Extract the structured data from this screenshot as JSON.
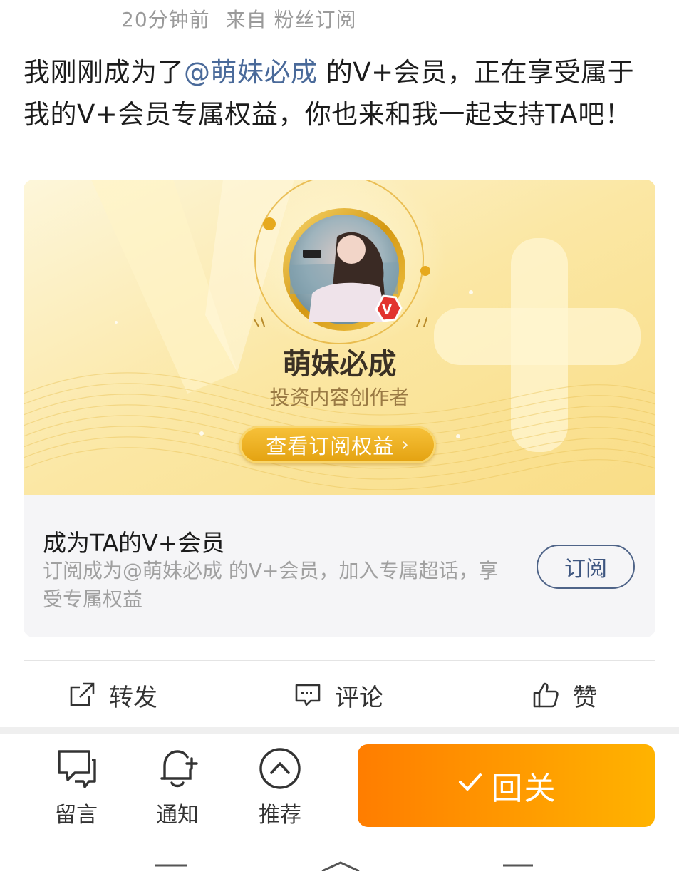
{
  "meta": {
    "time": "20分钟前",
    "source": "来自 粉丝订阅"
  },
  "post": {
    "prefix": "我刚刚成为了",
    "mention": "@萌妹必成",
    "suffix": " 的V+会员，正在享受属于我的V+会员专属权益，你也来和我一起支持TA吧！"
  },
  "card": {
    "creator_name": "萌妹必成",
    "creator_role": "投资内容创作者",
    "banner_button": "查看订阅权益",
    "badge_letter": "V",
    "footer_title": "成为TA的V+会员",
    "footer_desc": "订阅成为@萌妹必成 的V+会员，加入专属超话，享受专属权益",
    "subscribe_label": "订阅"
  },
  "actions": {
    "repost": "转发",
    "comment": "评论",
    "like": "赞"
  },
  "toolbar": {
    "message": "留言",
    "notify": "通知",
    "recommend": "推荐",
    "follow_back": "回关"
  },
  "colors": {
    "mention": "#4a6a9a",
    "follow_start": "#ff7d00",
    "follow_end": "#ffb300",
    "gold": "#e3a10f"
  },
  "icons": [
    "share-icon",
    "comment-icon",
    "thumbs-up-icon",
    "message-icon",
    "bell-plus-icon",
    "chevron-up-circle-icon",
    "check-icon",
    "chevron-right-icon"
  ]
}
